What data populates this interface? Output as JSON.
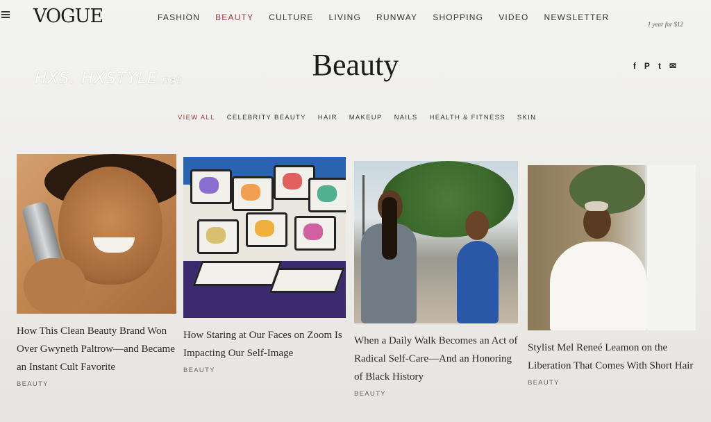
{
  "header": {
    "logo": "VOGUE",
    "nav": [
      {
        "label": "FASHION",
        "active": false
      },
      {
        "label": "BEAUTY",
        "active": true
      },
      {
        "label": "CULTURE",
        "active": false
      },
      {
        "label": "LIVING",
        "active": false
      },
      {
        "label": "RUNWAY",
        "active": false
      },
      {
        "label": "SHOPPING",
        "active": false
      },
      {
        "label": "VIDEO",
        "active": false
      },
      {
        "label": "NEWSLETTER",
        "active": false
      }
    ],
    "subscribe": "1 year for $12"
  },
  "watermark": {
    "main": "HXS. HXSTYLE",
    "suffix": ".net"
  },
  "page": {
    "title": "Beauty"
  },
  "social": [
    "f",
    "P",
    "t",
    "✉"
  ],
  "subnav": [
    {
      "label": "VIEW ALL",
      "active": true
    },
    {
      "label": "CELEBRITY BEAUTY",
      "active": false
    },
    {
      "label": "HAIR",
      "active": false
    },
    {
      "label": "MAKEUP",
      "active": false
    },
    {
      "label": "NAILS",
      "active": false
    },
    {
      "label": "HEALTH & FITNESS",
      "active": false
    },
    {
      "label": "SKIN",
      "active": false
    }
  ],
  "articles": [
    {
      "headline": "How This Clean Beauty Brand Won Over Gwyneth Paltrow—and Became an Instant Cult Favorite",
      "tag": "BEAUTY"
    },
    {
      "headline": "How Staring at Our Faces on Zoom Is Impacting Our Self-Image",
      "tag": "BEAUTY"
    },
    {
      "headline": "When a Daily Walk Becomes an Act of Radical Self-Care—And an Honoring of Black History",
      "tag": "BEAUTY"
    },
    {
      "headline": "Stylist Mel Reneé Leamon on the Liberation That Comes With Short Hair",
      "tag": "BEAUTY"
    }
  ],
  "colors": {
    "accent": "#9a3b3b",
    "text": "#222222"
  }
}
